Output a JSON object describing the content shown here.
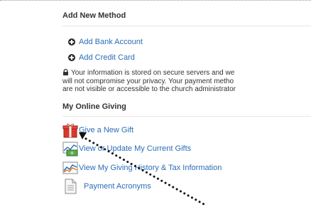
{
  "add_method": {
    "title": "Add New Method",
    "add_bank_label": "Add Bank Account",
    "add_card_label": "Add Credit Card",
    "notice": {
      "line1": "Your information is stored on secure servers and we",
      "line2": "will not compromise your privacy. Your payment metho",
      "line3": "are not visible or accessible to the church administrator"
    }
  },
  "online_giving": {
    "title": "My Online Giving",
    "links": {
      "give_new": "Give a New Gift",
      "view_update": "View or Update My Current Gifts",
      "history": "View My Giving History & Tax Information",
      "acronyms": "Payment Acronyms"
    }
  },
  "colors": {
    "link": "#2a6db5",
    "text": "#333333"
  }
}
